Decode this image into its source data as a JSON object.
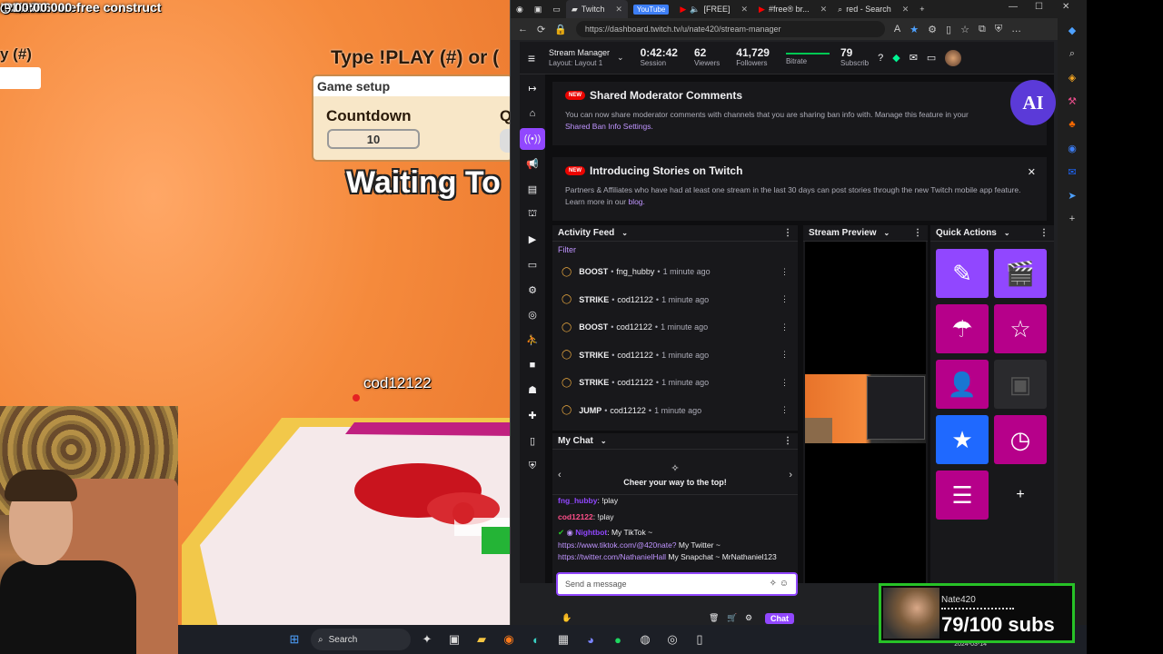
{
  "game": {
    "hud_title": "colorful carefree construct",
    "hud_players": "3/500",
    "hud_play": "!PLAY: 6",
    "hud_timer": "00:00.000",
    "left_play": "y (#)",
    "type_play": "Type !PLAY (#) or (",
    "setup_title": "Game setup",
    "countdown_label": "Countdown",
    "countdown_value": "10",
    "q_label": "Q",
    "waiting": "Waiting To",
    "player_name": "cod12122"
  },
  "browser": {
    "tabs": [
      {
        "label": "Twitch",
        "active": true
      },
      {
        "label": "YouTube",
        "active": false
      },
      {
        "label": "[FREE]",
        "active": false
      },
      {
        "label": "#free® br...",
        "active": false
      },
      {
        "label": "red - Search",
        "active": false
      }
    ],
    "url": "https://dashboard.twitch.tv/u/nate420/stream-manager"
  },
  "header": {
    "title": "Stream Manager",
    "subtitle": "Layout: Layout 1",
    "stats": [
      {
        "value": "0:42:42",
        "label": "Session"
      },
      {
        "value": "62",
        "label": "Viewers"
      },
      {
        "value": "41,729",
        "label": "Followers"
      },
      {
        "value": "",
        "label": "Bitrate"
      },
      {
        "value": "79",
        "label": "Subscrib"
      }
    ]
  },
  "notices": [
    {
      "badge": "NEW",
      "title": "Shared Moderator Comments",
      "text": "You can now share moderator comments with channels that you are sharing ban info with. Manage this feature in your",
      "link": "Shared Ban Info Settings."
    },
    {
      "badge": "NEW",
      "title": "Introducing Stories on Twitch",
      "text": "Partners & Affiliates who have had at least one stream in the last 30 days can post stories through the new Twitch mobile app feature. Learn more in our",
      "link": "blog."
    }
  ],
  "ai_badge": "AI",
  "activity": {
    "title": "Activity Feed",
    "filter": "Filter",
    "items": [
      {
        "kind": "BOOST",
        "user": "fng_hubby",
        "time": "1 minute ago"
      },
      {
        "kind": "STRIKE",
        "user": "cod12122",
        "time": "1 minute ago"
      },
      {
        "kind": "BOOST",
        "user": "cod12122",
        "time": "1 minute ago"
      },
      {
        "kind": "STRIKE",
        "user": "cod12122",
        "time": "1 minute ago"
      },
      {
        "kind": "STRIKE",
        "user": "cod12122",
        "time": "1 minute ago"
      },
      {
        "kind": "JUMP",
        "user": "cod12122",
        "time": "1 minute ago"
      }
    ]
  },
  "preview": {
    "title": "Stream Preview"
  },
  "quick_actions": {
    "title": "Quick Actions"
  },
  "chat": {
    "title": "My Chat",
    "cheer": "Cheer your way to the top!",
    "messages": [
      {
        "user": "fng_hubby",
        "text": "!play"
      },
      {
        "user": "cod12122",
        "text": "!play"
      },
      {
        "user": "Nightbot",
        "text": "My TikTok ~"
      }
    ],
    "nightbot_link1": "https://www.tiktok.com/@420nate?",
    "nightbot_text2": " My Twitter ~",
    "nightbot_link2": "https://twitter.com/NathanielHall",
    "nightbot_text3": " My Snapchat ~ MrNathaniel123",
    "placeholder": "Send a message",
    "chat_button": "Chat"
  },
  "taskbar": {
    "search": "Search",
    "date": "2024-03-14"
  },
  "subs": {
    "name": "Nate420",
    "count": "79/100 subs"
  }
}
